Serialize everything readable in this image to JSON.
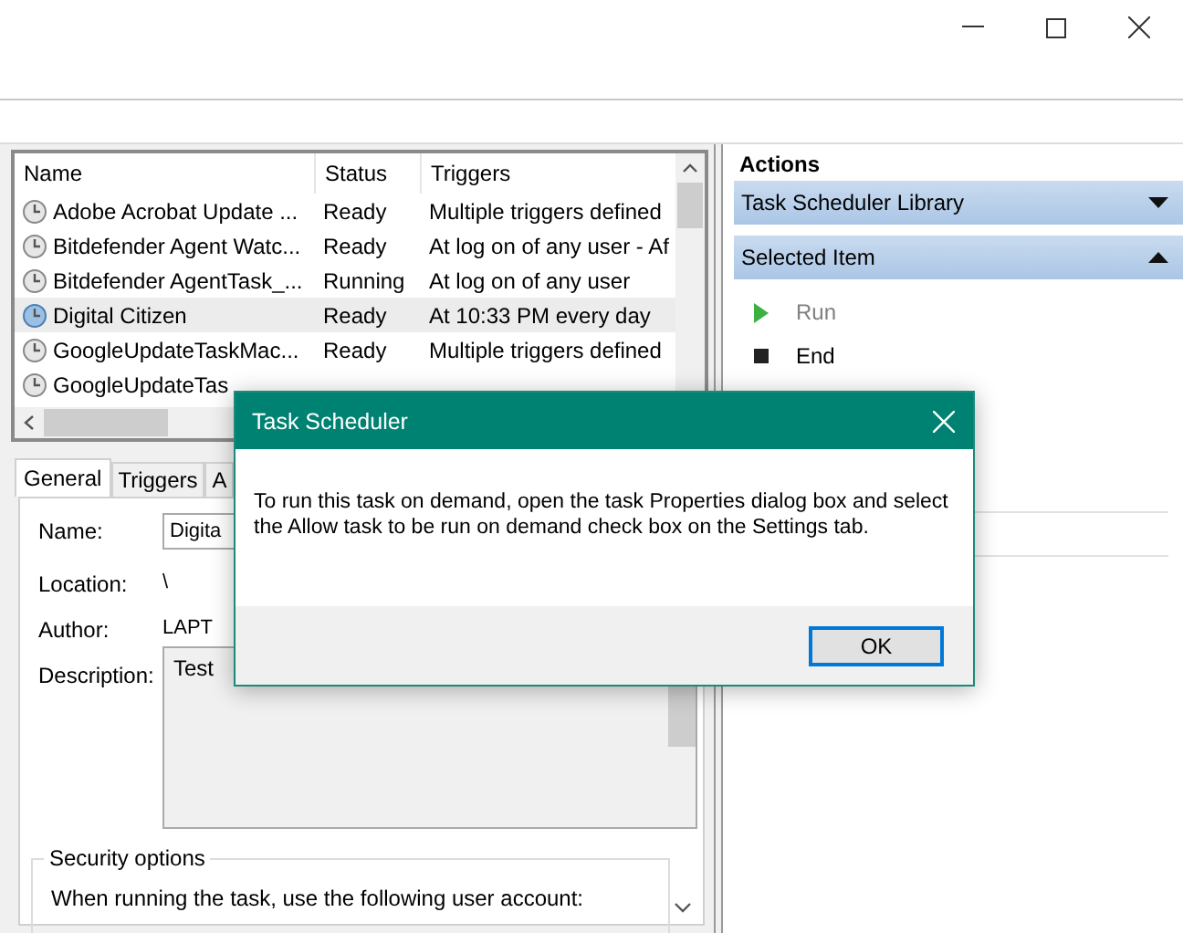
{
  "task_list": {
    "columns": [
      "Name",
      "Status",
      "Triggers"
    ],
    "rows": [
      {
        "name": "Adobe Acrobat Update ...",
        "status": "Ready",
        "triggers": "Multiple triggers defined",
        "selected": false
      },
      {
        "name": "Bitdefender Agent Watc...",
        "status": "Ready",
        "triggers": "At log on of any user - Af",
        "selected": false
      },
      {
        "name": "Bitdefender AgentTask_...",
        "status": "Running",
        "triggers": "At log on of any user",
        "selected": false
      },
      {
        "name": "Digital Citizen",
        "status": "Ready",
        "triggers": "At 10:33 PM every day",
        "selected": true
      },
      {
        "name": "GoogleUpdateTaskMac...",
        "status": "Ready",
        "triggers": "Multiple triggers defined",
        "selected": false
      },
      {
        "name": "GoogleUpdateTas",
        "selected": false
      }
    ]
  },
  "details": {
    "tabs": [
      {
        "label": "General",
        "selected": true
      },
      {
        "label": "Triggers",
        "selected": false
      },
      {
        "label": "A",
        "selected": false
      }
    ],
    "name_label": "Name:",
    "name_value": "Digita",
    "location_label": "Location:",
    "location_value": "\\",
    "author_label": "Author:",
    "author_value": "LAPT",
    "description_label": "Description:",
    "description_value": "Test",
    "security_title": "Security options",
    "account_text": "When running the task, use the following user account:"
  },
  "actions": {
    "title": "Actions",
    "sections": [
      {
        "title": "Task Scheduler Library",
        "expanded": false
      },
      {
        "title": "Selected Item",
        "expanded": true,
        "items": [
          {
            "kind": "run",
            "label": "Run",
            "disabled": true
          },
          {
            "kind": "end",
            "label": "End",
            "disabled": false
          }
        ]
      }
    ]
  },
  "dialog": {
    "title": "Task Scheduler",
    "message": "To run this task on demand, open the task Properties dialog box and select the Allow task to be run on demand check box on the Settings tab.",
    "button": "OK"
  }
}
